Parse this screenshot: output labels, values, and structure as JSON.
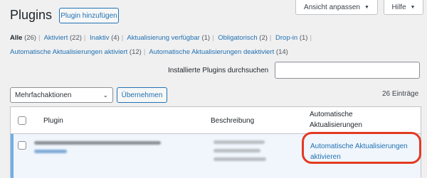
{
  "header": {
    "title": "Plugins",
    "add_button": "Plugin hinzufügen",
    "screen_options": "Ansicht anpassen",
    "help": "Hilfe"
  },
  "filters": [
    {
      "label": "Alle",
      "count": "(26)",
      "current": true
    },
    {
      "label": "Aktiviert",
      "count": "(22)"
    },
    {
      "label": "Inaktiv",
      "count": "(4)"
    },
    {
      "label": "Aktualisierung verfügbar",
      "count": "(1)"
    },
    {
      "label": "Obligatorisch",
      "count": "(2)"
    },
    {
      "label": "Drop-in",
      "count": "(1)"
    },
    {
      "label": "Automatische Aktualisierungen aktiviert",
      "count": "(12)"
    },
    {
      "label": "Automatische Aktualisierungen deaktiviert",
      "count": "(14)"
    }
  ],
  "search": {
    "label": "Installierte Plugins durchsuchen",
    "value": ""
  },
  "bulk": {
    "selected": "Mehrfachaktionen",
    "apply": "Übernehmen",
    "items_count": "26 Einträge"
  },
  "table": {
    "col_plugin": "Plugin",
    "col_description": "Beschreibung",
    "col_auto_line1": "Automatische",
    "col_auto_line2": "Aktualisierungen",
    "row": {
      "auto_update_line1": "Automatische Aktualisierungen",
      "auto_update_line2": "aktivieren"
    }
  },
  "colors": {
    "accent": "#2271b1",
    "highlight": "#e33a22",
    "active_row_border": "#72aee6",
    "active_row_bg": "#f0f6fc"
  }
}
